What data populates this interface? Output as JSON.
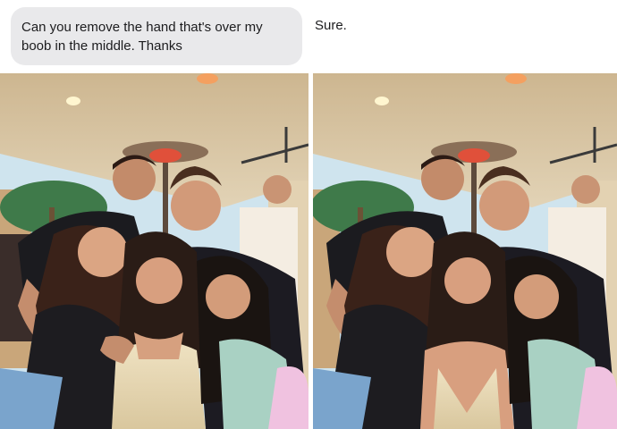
{
  "message": {
    "request_text": "Can you remove the hand that's over my boob in the middle. Thanks",
    "reply_text": "Sure."
  },
  "photos": {
    "original": {
      "label": ""
    },
    "edited": {
      "label": ""
    }
  },
  "colors": {
    "bubble_bg": "#e9e9eb",
    "text": "#1c1c1e",
    "ceiling": "#d9c7a6",
    "wall": "#cfae84",
    "sky": "#cfe4ee",
    "foliage": "#3f7a4a",
    "skin": "#d9a07e",
    "hair": "#2a1c16"
  }
}
